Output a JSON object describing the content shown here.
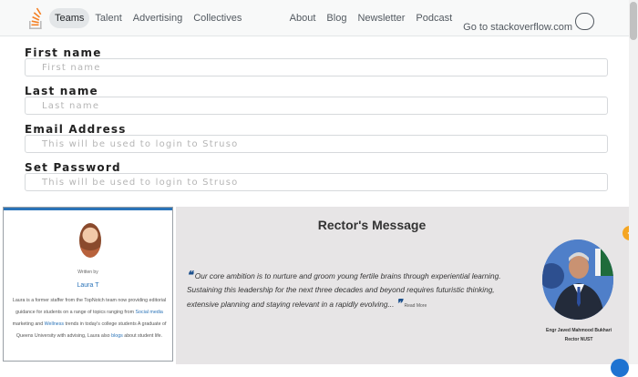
{
  "nav": {
    "left": [
      "Teams",
      "Talent",
      "Advertising",
      "Collectives"
    ],
    "right": [
      "About",
      "Blog",
      "Newsletter",
      "Podcast",
      "Go to stackoverflow.com"
    ]
  },
  "form": {
    "first_name_label": "First name",
    "first_name_placeholder": "First name",
    "last_name_label": "Last name",
    "last_name_placeholder": "Last name",
    "email_label": "Email Address",
    "email_placeholder": "This will be used to login to Struso",
    "password_label": "Set Password",
    "password_placeholder": "This will be used to login to Struso"
  },
  "profile": {
    "written_by": "Written by",
    "name": "Laura T",
    "bio_1": "Laura is a former staffer from the TopNotch team now providing editorial guidance for",
    "bio_2": "students on a range of topics ranging from",
    "bio_link_1": "Social media",
    "bio_3": "marketing",
    "bio_4": "and",
    "bio_link_2": "Wellness",
    "bio_5": "trends in today's",
    "bio_6": "college students",
    "bio_7": "A graduate of Queens University with advising, Laura also",
    "bio_link_3": "blogs",
    "bio_8": "about student life."
  },
  "rector": {
    "title": "Rector's Message",
    "quote": "Our core ambition is to nurture and groom young fertile brains through experiential learning. Sustaining this leadership for the next three decades and beyond requires futuristic thinking, extensive planning and staying relevant in a rapidly evolving...",
    "read_more": "Read More",
    "name": "Engr Javed Mahmood Bukhari",
    "role": "Rector NUST"
  },
  "colors": {
    "accent": "#f48024",
    "link": "#2a73b8",
    "quote_mark": "#1b4f8c",
    "panel": "#e7e5e6"
  }
}
